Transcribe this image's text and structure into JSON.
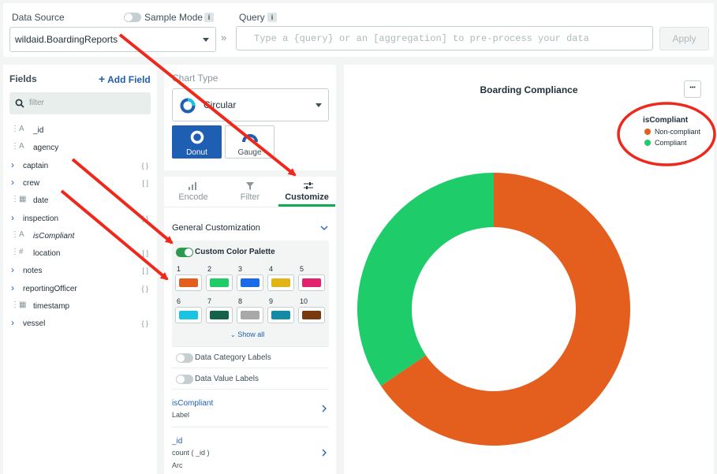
{
  "header": {
    "data_source_label": "Data Source",
    "data_source_value": "wildaid.BoardingReports",
    "sample_mode_label": "Sample Mode",
    "query_label": "Query",
    "query_placeholder": "Type a {query} or an [aggregation] to pre-process your data",
    "apply_label": "Apply",
    "info_glyph": "i",
    "chevrons": "»"
  },
  "fields": {
    "title": "Fields",
    "add_label": "Add Field",
    "search_placeholder": "filter",
    "items": [
      {
        "name": "_id",
        "type": "string",
        "expand": false,
        "bracket": "",
        "italic": false
      },
      {
        "name": "agency",
        "type": "string",
        "expand": false,
        "bracket": "",
        "italic": false
      },
      {
        "name": "captain",
        "type": "object",
        "expand": true,
        "bracket": "{ }",
        "italic": false
      },
      {
        "name": "crew",
        "type": "array",
        "expand": true,
        "bracket": "[ ]",
        "italic": false
      },
      {
        "name": "date",
        "type": "date",
        "expand": false,
        "bracket": "",
        "italic": false
      },
      {
        "name": "inspection",
        "type": "object",
        "expand": true,
        "bracket": "{ }",
        "italic": false
      },
      {
        "name": "isCompliant",
        "type": "string",
        "expand": false,
        "bracket": "",
        "italic": true
      },
      {
        "name": "location",
        "type": "number",
        "expand": false,
        "bracket": "[ ]",
        "italic": false
      },
      {
        "name": "notes",
        "type": "array",
        "expand": true,
        "bracket": "[ ]",
        "italic": false
      },
      {
        "name": "reportingOfficer",
        "type": "object",
        "expand": true,
        "bracket": "{ }",
        "italic": false
      },
      {
        "name": "timestamp",
        "type": "date",
        "expand": false,
        "bracket": "",
        "italic": false
      },
      {
        "name": "vessel",
        "type": "object",
        "expand": true,
        "bracket": "{ }",
        "italic": false
      }
    ]
  },
  "chart_type": {
    "label": "Chart Type",
    "selected": "Circular",
    "subtypes": [
      {
        "label": "Donut",
        "selected": true
      },
      {
        "label": "Gauge",
        "selected": false
      }
    ]
  },
  "tabs": [
    {
      "label": "Encode",
      "active": false
    },
    {
      "label": "Filter",
      "active": false
    },
    {
      "label": "Customize",
      "active": true
    }
  ],
  "customize": {
    "section_title": "General Customization",
    "palette_label": "Custom Color Palette",
    "palette": [
      {
        "n": "1",
        "color": "#e45f1e"
      },
      {
        "n": "2",
        "color": "#1ecd69"
      },
      {
        "n": "3",
        "color": "#1a6be8"
      },
      {
        "n": "4",
        "color": "#e3b416"
      },
      {
        "n": "5",
        "color": "#e4236f"
      },
      {
        "n": "6",
        "color": "#19c4e2"
      },
      {
        "n": "7",
        "color": "#14624a"
      },
      {
        "n": "8",
        "color": "#a8a8a8"
      },
      {
        "n": "9",
        "color": "#148aa4"
      },
      {
        "n": "10",
        "color": "#7a3a10"
      }
    ],
    "show_all": "Show all",
    "category_labels": "Data Category Labels",
    "value_labels": "Data Value Labels",
    "encodings": [
      {
        "title": "isCompliant",
        "sub": "",
        "kind": "Label"
      },
      {
        "title": "_id",
        "sub": "count ( _id )",
        "kind": "Arc"
      }
    ]
  },
  "chart": {
    "title": "Boarding Compliance",
    "menu_glyph": "•••",
    "legend_title": "isCompliant"
  },
  "chart_data": {
    "type": "pie",
    "title": "Boarding Compliance",
    "categories": [
      "Non-compliant",
      "Compliant"
    ],
    "values": [
      65.5,
      34.5
    ],
    "colors": [
      "#e45f1e",
      "#1ecd69"
    ],
    "donut": true,
    "legend": "top-right"
  }
}
